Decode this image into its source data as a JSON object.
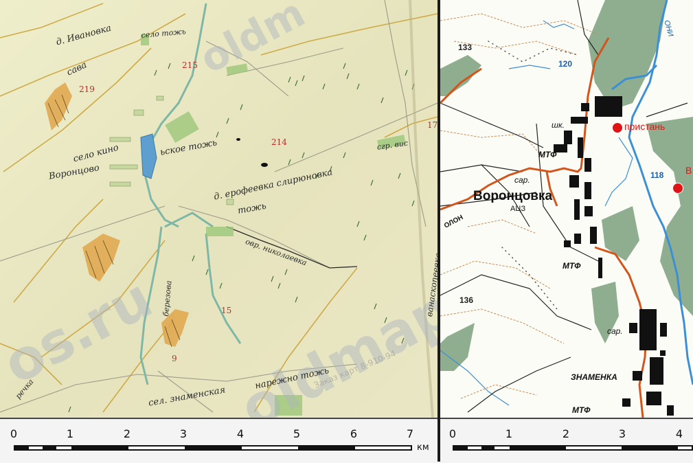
{
  "left_map": {
    "watermarks": {
      "brand": "oldmaps.ru",
      "brand_partial": "os.ru",
      "brand_top": "oldm",
      "order": "Заказ карт 8-910-94"
    },
    "labels": {
      "village_ivanovka": "д. Ивановка",
      "sava": "сава",
      "selo_kino": "село кино",
      "voronieshko": "Воронцово",
      "eskoe_tozh": "ьское тожь",
      "erofeevka": "д. ерофеевка слирюновка",
      "tozh": "тожь",
      "selo_top": "село тожь",
      "ovr_nikolaevka": "овр. николаевка",
      "berezovaya": "березова",
      "selo_znamensk": "сел. знаменская",
      "narezhno": "нарежно тожь",
      "rechka": "речка",
      "right_vertical": "ванаскопеевка",
      "sgr": "сгр. вис"
    },
    "numbers": {
      "n219": "219",
      "n215": "215",
      "n214": "214",
      "n15": "15",
      "n9": "9",
      "n17": "17"
    }
  },
  "right_map": {
    "town": "Воронцовка",
    "znamenka": "ЗНАМЕНКА",
    "poi": {
      "pristan": "пристань",
      "b": "В"
    },
    "abbr": {
      "shk": "шк.",
      "mtf1": "МТФ",
      "sar1": "сар.",
      "ats": "АЦЗ",
      "mtf2": "МТФ",
      "sar2": "сар.",
      "mtf3": "МТФ",
      "road": "ОЛОН"
    },
    "elevations": {
      "e133": "133",
      "e120": "120",
      "e118": "118",
      "e136": "136"
    },
    "rivers": {
      "top_right": "ОНИ"
    }
  },
  "scalebar_left": {
    "ticks": [
      "0",
      "1",
      "2",
      "3",
      "4",
      "5",
      "6",
      "7"
    ],
    "unit": "км"
  },
  "scalebar_right": {
    "ticks": [
      "0",
      "1",
      "2",
      "3",
      "4"
    ]
  },
  "colors": {
    "river": "#3b8fd6",
    "road": "#d2551c",
    "forest": "#8fae8f",
    "parchment": "#ecebc7",
    "poi": "#e01414"
  }
}
